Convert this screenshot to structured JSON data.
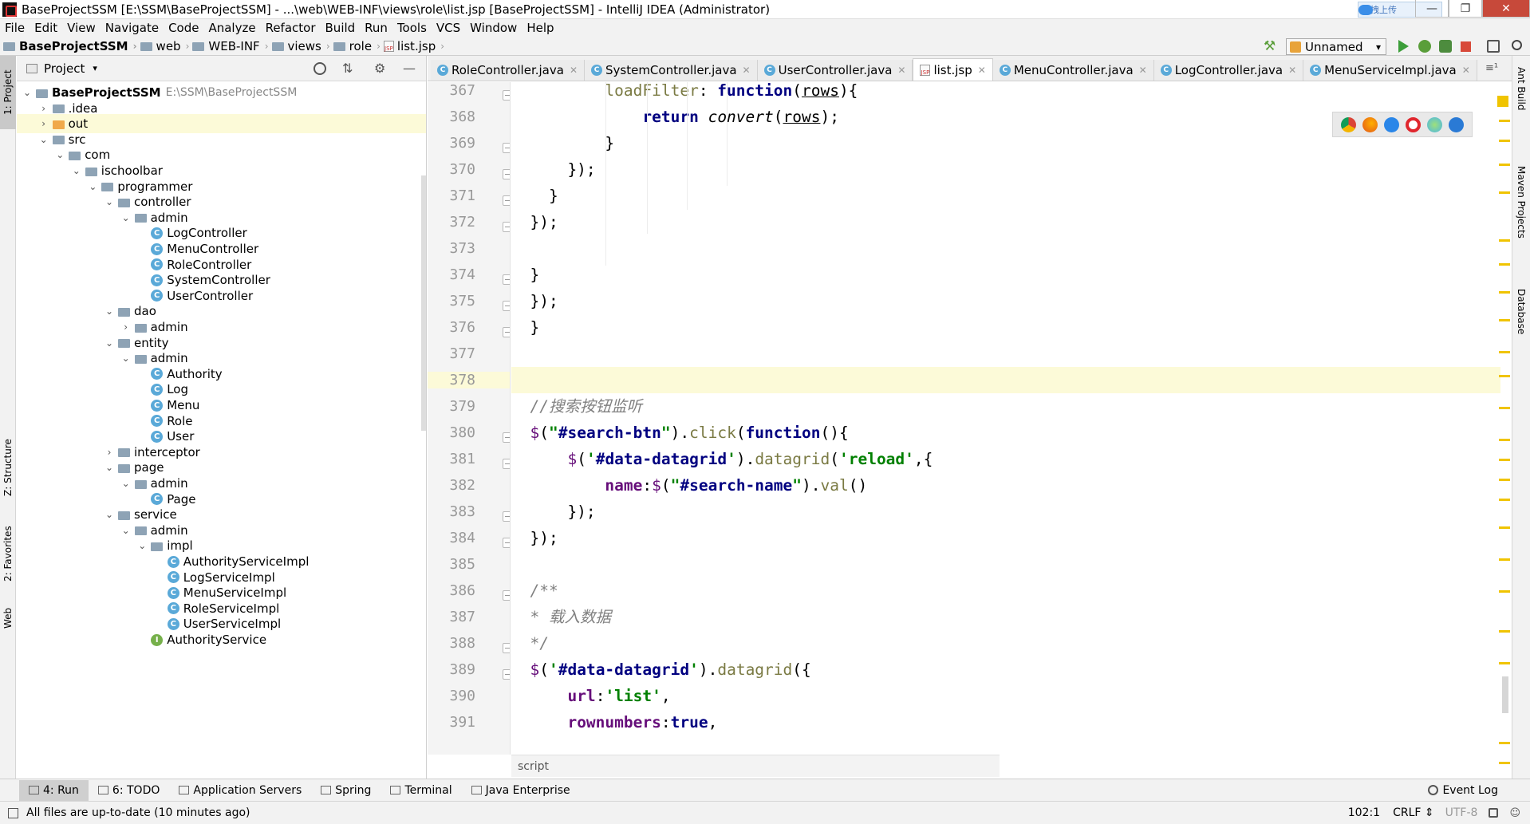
{
  "window": {
    "title": "BaseProjectSSM [E:\\SSM\\BaseProjectSSM] - ...\\web\\WEB-INF\\views\\role\\list.jsp [BaseProjectSSM] - IntelliJ IDEA (Administrator)",
    "upload_label": "拖拽上传"
  },
  "menu": [
    "File",
    "Edit",
    "View",
    "Navigate",
    "Code",
    "Analyze",
    "Refactor",
    "Build",
    "Run",
    "Tools",
    "VCS",
    "Window",
    "Help"
  ],
  "nav": {
    "crumbs": [
      "BaseProjectSSM",
      "web",
      "WEB-INF",
      "views",
      "role",
      "list.jsp"
    ],
    "run_config": "Unnamed"
  },
  "left_strip": {
    "project": "1: Project",
    "structure": "Z: Structure",
    "favorites": "2: Favorites",
    "web": "Web"
  },
  "right_strip": {
    "ant": "Ant Build",
    "maven": "Maven Projects",
    "database": "Database"
  },
  "project_panel": {
    "title": "Project",
    "tree": [
      {
        "label": "BaseProjectSSM",
        "secondary": "E:\\SSM\\BaseProjectSSM",
        "level": 0,
        "arrow": "down",
        "icon": "folder",
        "bold": true
      },
      {
        "label": ".idea",
        "level": 1,
        "arrow": "right",
        "icon": "folder"
      },
      {
        "label": "out",
        "level": 1,
        "arrow": "right",
        "icon": "folder-orange",
        "highlight": true
      },
      {
        "label": "src",
        "level": 1,
        "arrow": "down",
        "icon": "folder"
      },
      {
        "label": "com",
        "level": 2,
        "arrow": "down",
        "icon": "folder"
      },
      {
        "label": "ischoolbar",
        "level": 3,
        "arrow": "down",
        "icon": "folder"
      },
      {
        "label": "programmer",
        "level": 4,
        "arrow": "down",
        "icon": "folder"
      },
      {
        "label": "controller",
        "level": 5,
        "arrow": "down",
        "icon": "folder"
      },
      {
        "label": "admin",
        "level": 6,
        "arrow": "down",
        "icon": "folder"
      },
      {
        "label": "LogController",
        "level": 7,
        "arrow": "",
        "icon": "class"
      },
      {
        "label": "MenuController",
        "level": 7,
        "arrow": "",
        "icon": "class"
      },
      {
        "label": "RoleController",
        "level": 7,
        "arrow": "",
        "icon": "class"
      },
      {
        "label": "SystemController",
        "level": 7,
        "arrow": "",
        "icon": "class"
      },
      {
        "label": "UserController",
        "level": 7,
        "arrow": "",
        "icon": "class"
      },
      {
        "label": "dao",
        "level": 5,
        "arrow": "down",
        "icon": "folder"
      },
      {
        "label": "admin",
        "level": 6,
        "arrow": "right",
        "icon": "folder"
      },
      {
        "label": "entity",
        "level": 5,
        "arrow": "down",
        "icon": "folder"
      },
      {
        "label": "admin",
        "level": 6,
        "arrow": "down",
        "icon": "folder"
      },
      {
        "label": "Authority",
        "level": 7,
        "arrow": "",
        "icon": "class"
      },
      {
        "label": "Log",
        "level": 7,
        "arrow": "",
        "icon": "class"
      },
      {
        "label": "Menu",
        "level": 7,
        "arrow": "",
        "icon": "class"
      },
      {
        "label": "Role",
        "level": 7,
        "arrow": "",
        "icon": "class"
      },
      {
        "label": "User",
        "level": 7,
        "arrow": "",
        "icon": "class"
      },
      {
        "label": "interceptor",
        "level": 5,
        "arrow": "right",
        "icon": "folder"
      },
      {
        "label": "page",
        "level": 5,
        "arrow": "down",
        "icon": "folder"
      },
      {
        "label": "admin",
        "level": 6,
        "arrow": "down",
        "icon": "folder"
      },
      {
        "label": "Page",
        "level": 7,
        "arrow": "",
        "icon": "class"
      },
      {
        "label": "service",
        "level": 5,
        "arrow": "down",
        "icon": "folder"
      },
      {
        "label": "admin",
        "level": 6,
        "arrow": "down",
        "icon": "folder"
      },
      {
        "label": "impl",
        "level": 7,
        "arrow": "down",
        "icon": "folder"
      },
      {
        "label": "AuthorityServiceImpl",
        "level": 8,
        "arrow": "",
        "icon": "class"
      },
      {
        "label": "LogServiceImpl",
        "level": 8,
        "arrow": "",
        "icon": "class"
      },
      {
        "label": "MenuServiceImpl",
        "level": 8,
        "arrow": "",
        "icon": "class"
      },
      {
        "label": "RoleServiceImpl",
        "level": 8,
        "arrow": "",
        "icon": "class"
      },
      {
        "label": "UserServiceImpl",
        "level": 8,
        "arrow": "",
        "icon": "class"
      },
      {
        "label": "AuthorityService",
        "level": 7,
        "arrow": "",
        "icon": "interface"
      }
    ]
  },
  "editor": {
    "tabs": [
      {
        "label": "RoleController.java",
        "icon": "class"
      },
      {
        "label": "SystemController.java",
        "icon": "class"
      },
      {
        "label": "UserController.java",
        "icon": "class"
      },
      {
        "label": "list.jsp",
        "icon": "jsp",
        "active": true
      },
      {
        "label": "MenuController.java",
        "icon": "class"
      },
      {
        "label": "LogController.java",
        "icon": "class"
      },
      {
        "label": "MenuServiceImpl.java",
        "icon": "class"
      }
    ],
    "tab_overflow": "≡¹",
    "line_numbers": [
      "367",
      "368",
      "369",
      "370",
      "371",
      "372",
      "373",
      "374",
      "375",
      "376",
      "377",
      "378",
      "379",
      "380",
      "381",
      "382",
      "383",
      "384",
      "385",
      "386",
      "387",
      "388",
      "389",
      "390",
      "391"
    ],
    "code_breadcrumb": "script"
  },
  "bottom_tools": [
    {
      "label": "4: Run",
      "active": true
    },
    {
      "label": "6: TODO"
    },
    {
      "label": "Application Servers"
    },
    {
      "label": "Spring"
    },
    {
      "label": "Terminal"
    },
    {
      "label": "Java Enterprise"
    }
  ],
  "event_log": "Event Log",
  "status": {
    "message": "All files are up-to-date (10 minutes ago)",
    "position": "102:1",
    "line_sep": "CRLF ⇕",
    "encoding": "UTF-8"
  }
}
